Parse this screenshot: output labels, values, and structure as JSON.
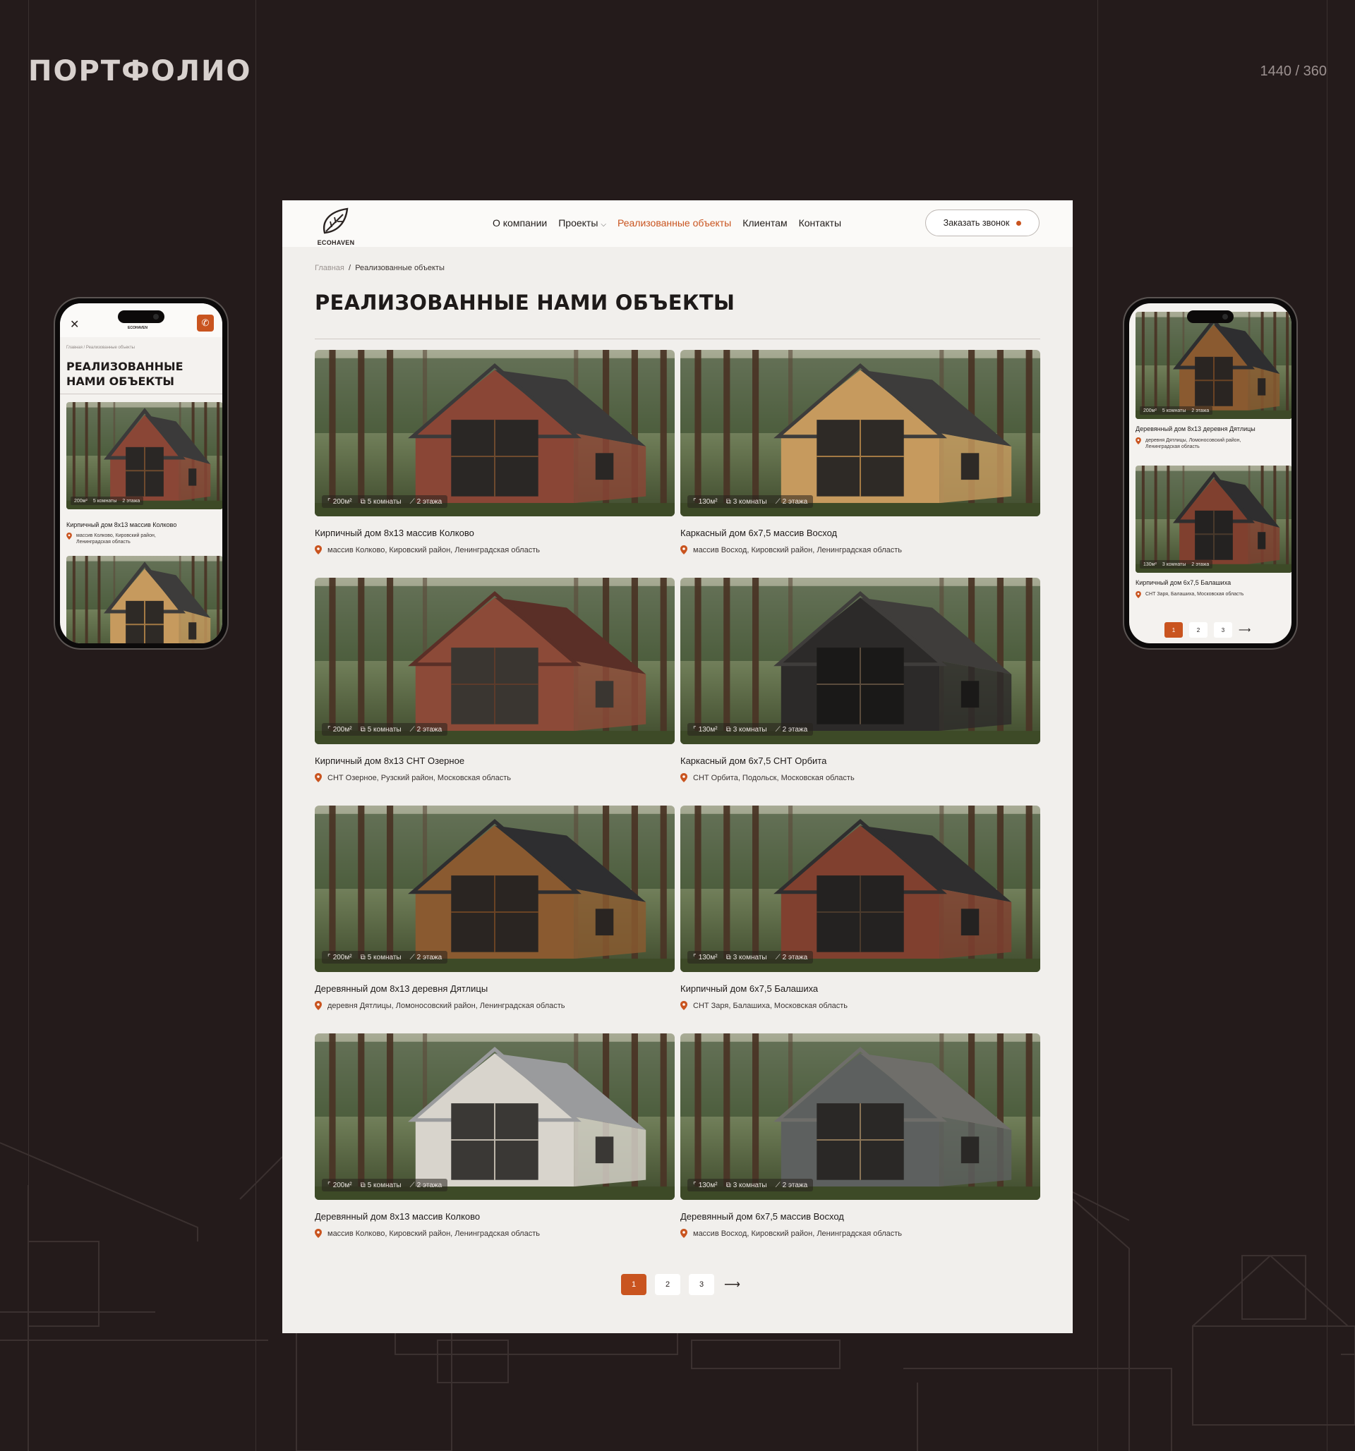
{
  "portfolio": {
    "title": "ПОРТФОЛИО",
    "size_label": "1440 / 360"
  },
  "brand": {
    "name": "ECOHAVEN",
    "accent": "#c9541f",
    "background": "#241b1b"
  },
  "nav": {
    "items": [
      {
        "label": "О компании",
        "active": false
      },
      {
        "label": "Проекты",
        "active": false,
        "has_dropdown": true
      },
      {
        "label": "Реализованные объекты",
        "active": true
      },
      {
        "label": "Клиентам",
        "active": false
      },
      {
        "label": "Контакты",
        "active": false
      }
    ],
    "cta": "Заказать звонок"
  },
  "breadcrumb": {
    "home": "Главная",
    "separator": "/",
    "current": "Реализованные объекты"
  },
  "page_title": "РЕАЛИЗОВАННЫЕ НАМИ ОБЪЕКТЫ",
  "mobile_page_title_lines": [
    "РЕАЛИЗОВАННЫЕ",
    "НАМИ ОБЪЕКТЫ"
  ],
  "projects": [
    {
      "title": "Кирпичный дом 8х13 массив Колково",
      "location": "массив Колково, Кировский район, Ленинградская область",
      "area": "200м²",
      "rooms": "5 комнаты",
      "floors": "2 этажа",
      "style": "brick"
    },
    {
      "title": "Каркасный дом 6х7,5 массив Восход",
      "location": "массив Восход, Кировский район, Ленинградская область",
      "area": "130м²",
      "rooms": "3 комнаты",
      "floors": "2 этажа",
      "style": "frame"
    },
    {
      "title": "Кирпичный дом 8х13  СНТ Озерное",
      "location": "СНТ Озерное, Рузский район, Московская область",
      "area": "200м²",
      "rooms": "5 комнаты",
      "floors": "2 этажа",
      "style": "brick2"
    },
    {
      "title": "Каркасный дом 6х7,5 СНТ Орбита",
      "location": "СНТ Орбита, Подольск, Московская область",
      "area": "130м²",
      "rooms": "3 комнаты",
      "floors": "2 этажа",
      "style": "dark"
    },
    {
      "title": "Деревянный дом 8х13 деревня Дятлицы",
      "location": "деревня Дятлицы, Ломоносовский район, Ленинградская область",
      "area": "200м²",
      "rooms": "5 комнаты",
      "floors": "2 этажа",
      "style": "log"
    },
    {
      "title": "Кирпичный дом 6х7,5 Балашиха",
      "location": "СНТ Заря, Балашиха, Московская область",
      "area": "130м²",
      "rooms": "3 комнаты",
      "floors": "2 этажа",
      "style": "brick3"
    },
    {
      "title": "Деревянный дом 8х13 массив Колково",
      "location": "массив Колково, Кировский район, Ленинградская область",
      "area": "200м²",
      "rooms": "5 комнаты",
      "floors": "2 этажа",
      "style": "white"
    },
    {
      "title": "Деревянный дом 6х7,5 массив Восход",
      "location": "массив Восход, Кировский район, Ленинградская область",
      "area": "130м²",
      "rooms": "3 комнаты",
      "floors": "2 этажа",
      "style": "grey"
    }
  ],
  "pagination": {
    "pages": [
      "1",
      "2",
      "3"
    ],
    "current": "1",
    "next_symbol": "⟶"
  },
  "mobile_left": {
    "breadcrumb": "Главная / Реализованные объекты",
    "card_title": "Кирпичный дом 8х13 массив Колково",
    "card_location_lines": [
      "массив Колково, Кировский район,",
      "Ленинградская область"
    ]
  },
  "mobile_right": {
    "card1_title": "Деревянный дом 8х13 деревня Дятлицы",
    "card1_location_lines": [
      "деревня Дятлицы, Ломоносовский район,",
      "Ленинградская область"
    ],
    "card2_title": "Кирпичный дом 6х7,5 Балашиха",
    "card2_location": "СНТ Заря, Балашиха, Московская область"
  },
  "icons": [
    "leaf-logo-icon",
    "area-icon",
    "rooms-icon",
    "stairs-icon",
    "location-pin-icon",
    "chevron-down-icon",
    "close-icon",
    "phone-icon",
    "arrow-right-icon"
  ]
}
